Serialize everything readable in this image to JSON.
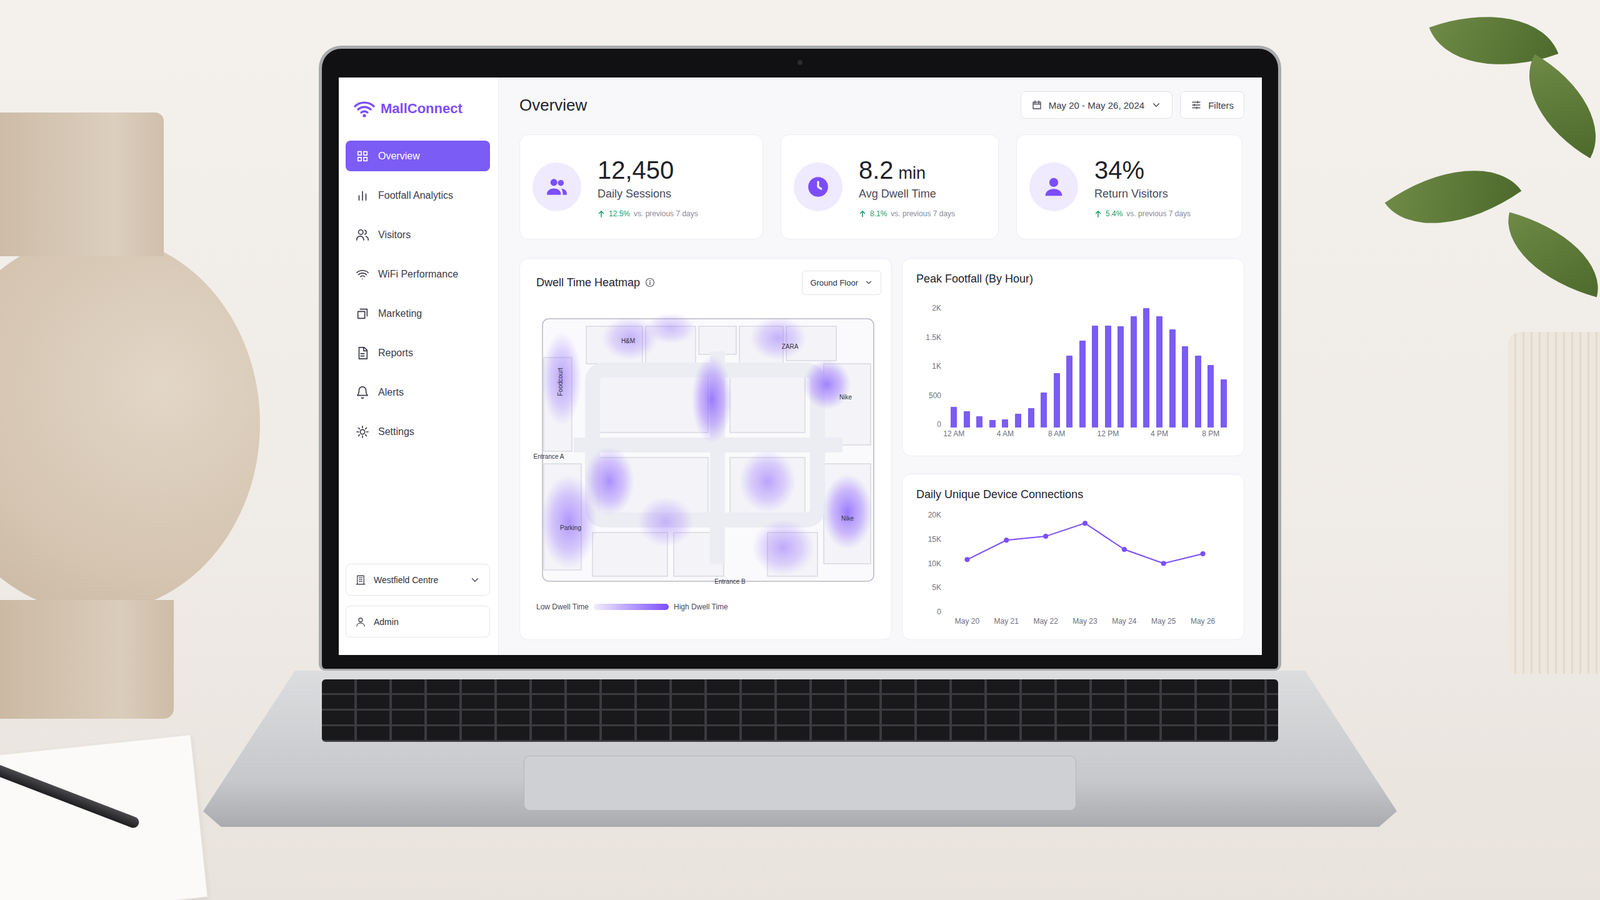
{
  "app": {
    "brand": "MallConnect"
  },
  "sidebar": {
    "items": [
      {
        "label": "Overview",
        "selected": true
      },
      {
        "label": "Footfall Analytics",
        "selected": false
      },
      {
        "label": "Visitors",
        "selected": false
      },
      {
        "label": "WiFi Performance",
        "selected": false
      },
      {
        "label": "Marketing",
        "selected": false
      },
      {
        "label": "Reports",
        "selected": false
      },
      {
        "label": "Alerts",
        "selected": false
      },
      {
        "label": "Settings",
        "selected": false
      }
    ],
    "site": "Westfield Centre",
    "user": "Admin"
  },
  "header": {
    "title": "Overview",
    "date_range": "May 20 - May 26, 2024",
    "filters": "Filters"
  },
  "stats": [
    {
      "value": "12,450",
      "unit": "",
      "label": "Daily Sessions",
      "change": "12.5%",
      "compare": "vs. previous 7 days"
    },
    {
      "value": "8.2",
      "unit": "min",
      "label": "Avg Dwell Time",
      "change": "8.1%",
      "compare": "vs. previous 7 days"
    },
    {
      "value": "34%",
      "unit": "",
      "label": "Return Visitors",
      "change": "5.4%",
      "compare": "vs. previous 7 days"
    }
  ],
  "heatmap": {
    "title": "Dwell Time Heatmap",
    "floor": "Ground Floor",
    "labels": [
      "H&M",
      "ZARA",
      "Foodcourt",
      "Nike",
      "Entrance A",
      "Parking",
      "Nike",
      "Entrance B"
    ],
    "zones": [
      0.6,
      0.5,
      0.4,
      0.9,
      0.5,
      0.85,
      0.75,
      0.7,
      0.6,
      0.9,
      0.55,
      0.45
    ],
    "legend_low": "Low Dwell Time",
    "legend_high": "High Dwell Time"
  },
  "peak_footfall": {
    "title": "Peak Footfall (By Hour)",
    "y_ticks": [
      "2K",
      "1.5K",
      "1K",
      "500",
      "0"
    ],
    "y_max": 2000,
    "x_labels": [
      "12 AM",
      "4 AM",
      "8 AM",
      "12 PM",
      "4 PM",
      "8 PM"
    ],
    "values": [
      350,
      280,
      190,
      120,
      140,
      230,
      330,
      600,
      930,
      1230,
      1490,
      1750,
      1750,
      1740,
      1910,
      2050,
      1910,
      1680,
      1390,
      1230,
      1070,
      820
    ]
  },
  "connections": {
    "title": "Daily Unique Device Connections",
    "y_ticks": [
      "20K",
      "15K",
      "10K",
      "5K",
      "0"
    ],
    "y_max": 20000,
    "x_labels": [
      "May 20",
      "May 21",
      "May 22",
      "May 23",
      "May 24",
      "May 25",
      "May 26"
    ],
    "values": [
      10800,
      14800,
      15600,
      18300,
      12900,
      10000,
      12000
    ]
  }
}
